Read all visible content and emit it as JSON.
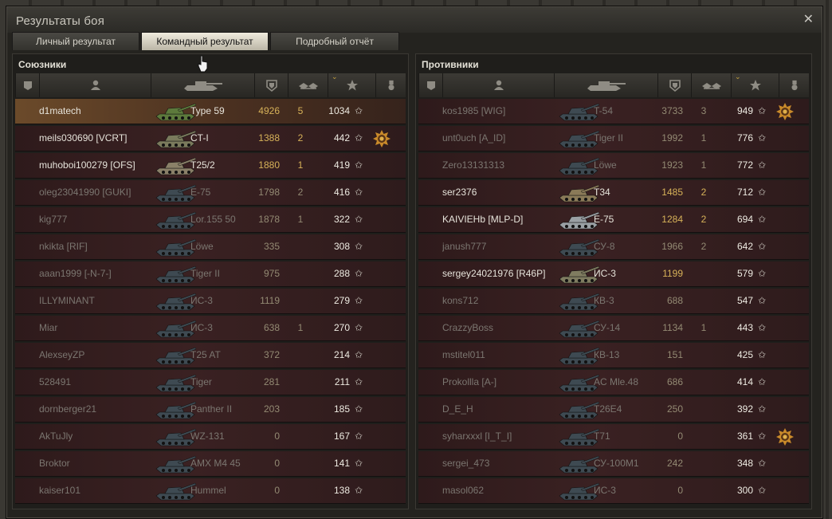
{
  "window": {
    "title": "Результаты боя",
    "close_glyph": "✕"
  },
  "tabs": [
    {
      "label": "Личный результат",
      "active": false
    },
    {
      "label": "Командный результат",
      "active": true
    },
    {
      "label": "Подробный отчёт",
      "active": false
    }
  ],
  "columns": {
    "icons": [
      "platoon-icon",
      "player-icon",
      "vehicle-icon",
      "damage-icon",
      "kills-icon",
      "experience-icon",
      "medal-icon"
    ],
    "sorted_by": "experience"
  },
  "allies": {
    "title": "Союзники",
    "rows": [
      {
        "player": "d1matech",
        "tank": "Type 59",
        "damage": "4926",
        "kills": "5",
        "xp": "1034",
        "medal": false,
        "alive": true,
        "me": true,
        "camo": "#5d7a3c"
      },
      {
        "player": "meils030690 [VCRT]",
        "tank": "CT-I",
        "damage": "1388",
        "kills": "2",
        "xp": "442",
        "medal": true,
        "alive": true,
        "camo": "#7a7a5c"
      },
      {
        "player": "muhoboi100279 [OFS]",
        "tank": "T25/2",
        "damage": "1880",
        "kills": "1",
        "xp": "419",
        "medal": false,
        "alive": true,
        "camo": "#8a8068"
      },
      {
        "player": "oleg23041990 [GUKI]",
        "tank": "E-75",
        "damage": "1798",
        "kills": "2",
        "xp": "416",
        "medal": false,
        "alive": false,
        "camo": "#3e4a52"
      },
      {
        "player": "kig777",
        "tank": "Lor.155 50",
        "damage": "1878",
        "kills": "1",
        "xp": "322",
        "medal": false,
        "alive": false,
        "camo": "#3e4a52"
      },
      {
        "player": "nkikta [RIF]",
        "tank": "Löwe",
        "damage": "335",
        "kills": "",
        "xp": "308",
        "medal": false,
        "alive": false,
        "camo": "#3e4a52"
      },
      {
        "player": "aaan1999 [-N-7-]",
        "tank": "Tiger II",
        "damage": "975",
        "kills": "",
        "xp": "288",
        "medal": false,
        "alive": false,
        "camo": "#3e4a52"
      },
      {
        "player": "ILLYMINANT",
        "tank": "ИС-3",
        "damage": "1119",
        "kills": "",
        "xp": "279",
        "medal": false,
        "alive": false,
        "camo": "#3e4a52"
      },
      {
        "player": "Miar",
        "tank": "ИС-3",
        "damage": "638",
        "kills": "1",
        "xp": "270",
        "medal": false,
        "alive": false,
        "camo": "#3e4a52"
      },
      {
        "player": "AlexseyZP",
        "tank": "T25 AT",
        "damage": "372",
        "kills": "",
        "xp": "214",
        "medal": false,
        "alive": false,
        "camo": "#3e4a52"
      },
      {
        "player": "528491",
        "tank": "Tiger",
        "damage": "281",
        "kills": "",
        "xp": "211",
        "medal": false,
        "alive": false,
        "camo": "#3e4a52"
      },
      {
        "player": "dornberger21",
        "tank": "Panther II",
        "damage": "203",
        "kills": "",
        "xp": "185",
        "medal": false,
        "alive": false,
        "camo": "#3e4a52"
      },
      {
        "player": "AkTuJly",
        "tank": "WZ-131",
        "damage": "0",
        "kills": "",
        "xp": "167",
        "medal": false,
        "alive": false,
        "camo": "#3e4a52"
      },
      {
        "player": "Broktor",
        "tank": "AMX M4 45",
        "damage": "0",
        "kills": "",
        "xp": "141",
        "medal": false,
        "alive": false,
        "camo": "#3e4a52"
      },
      {
        "player": "kaiser101",
        "tank": "Hummel",
        "damage": "0",
        "kills": "",
        "xp": "138",
        "medal": false,
        "alive": false,
        "camo": "#3e4a52"
      }
    ]
  },
  "enemies": {
    "title": "Противники",
    "rows": [
      {
        "player": "kos1985 [WIG]",
        "tank": "T-54",
        "damage": "3733",
        "kills": "3",
        "xp": "949",
        "medal": true,
        "alive": false,
        "camo": "#3e4a52"
      },
      {
        "player": "unt0uch [A_ID]",
        "tank": "Tiger II",
        "damage": "1992",
        "kills": "1",
        "xp": "776",
        "medal": false,
        "alive": false,
        "camo": "#3e4a52"
      },
      {
        "player": "Zero13131313",
        "tank": "Löwe",
        "damage": "1923",
        "kills": "1",
        "xp": "772",
        "medal": false,
        "alive": false,
        "camo": "#3e4a52"
      },
      {
        "player": "ser2376",
        "tank": "T34",
        "damage": "1485",
        "kills": "2",
        "xp": "712",
        "medal": false,
        "alive": true,
        "camo": "#8a7a58"
      },
      {
        "player": "KAIVIEHb [MLP-D]",
        "tank": "E-75",
        "damage": "1284",
        "kills": "2",
        "xp": "694",
        "medal": false,
        "alive": true,
        "camo": "#9aa0a4"
      },
      {
        "player": "janush777",
        "tank": "СУ-8",
        "damage": "1966",
        "kills": "2",
        "xp": "642",
        "medal": false,
        "alive": false,
        "camo": "#3e4a52"
      },
      {
        "player": "sergey24021976 [R46P]",
        "tank": "ИС-3",
        "damage": "1199",
        "kills": "",
        "xp": "579",
        "medal": false,
        "alive": true,
        "camo": "#7f7c60"
      },
      {
        "player": "kons712",
        "tank": "КВ-3",
        "damage": "688",
        "kills": "",
        "xp": "547",
        "medal": false,
        "alive": false,
        "camo": "#3e4a52"
      },
      {
        "player": "CrazzyBoss",
        "tank": "СУ-14",
        "damage": "1134",
        "kills": "1",
        "xp": "443",
        "medal": false,
        "alive": false,
        "camo": "#3e4a52"
      },
      {
        "player": "mstitel011",
        "tank": "КВ-13",
        "damage": "151",
        "kills": "",
        "xp": "425",
        "medal": false,
        "alive": false,
        "camo": "#3e4a52"
      },
      {
        "player": "Prokollla [A-]",
        "tank": "AC Mle.48",
        "damage": "686",
        "kills": "",
        "xp": "414",
        "medal": false,
        "alive": false,
        "camo": "#3e4a52"
      },
      {
        "player": "D_E_H",
        "tank": "T26E4",
        "damage": "250",
        "kills": "",
        "xp": "392",
        "medal": false,
        "alive": false,
        "camo": "#3e4a52"
      },
      {
        "player": "syharxxxl [I_T_I]",
        "tank": "T71",
        "damage": "0",
        "kills": "",
        "xp": "361",
        "medal": true,
        "alive": false,
        "camo": "#3e4a52"
      },
      {
        "player": "sergei_473",
        "tank": "СУ-100М1",
        "damage": "242",
        "kills": "",
        "xp": "348",
        "medal": false,
        "alive": false,
        "camo": "#3e4a52"
      },
      {
        "player": "masol062",
        "tank": "ИС-3",
        "damage": "0",
        "kills": "",
        "xp": "300",
        "medal": false,
        "alive": false,
        "camo": "#3e4a52"
      }
    ]
  },
  "colors": {
    "alive_text": "#e6e3da",
    "dead_text": "#7b7670",
    "damage_alive": "#d7b259",
    "damage_dead": "#938a73",
    "medal": "#c98a2a"
  }
}
